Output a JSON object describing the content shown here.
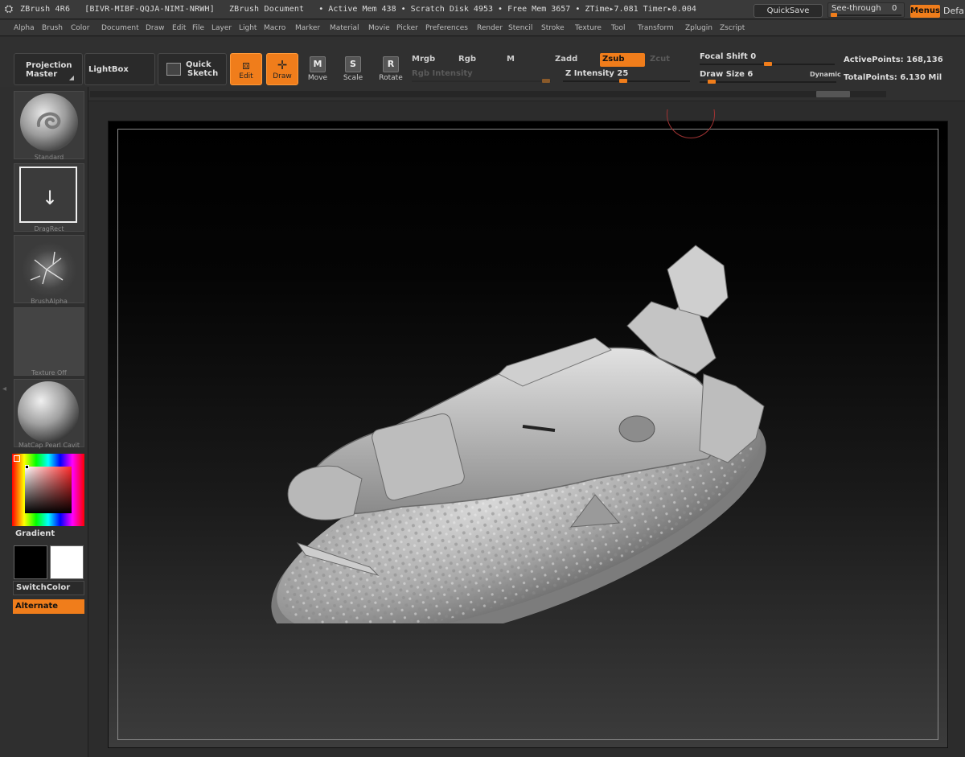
{
  "titlebar": {
    "app": "ZBrush 4R6",
    "serial": "[BIVR-MIBF-QQJA-NIMI-NRWH]",
    "document": "ZBrush Document",
    "stats": "• Active Mem 438 • Scratch Disk 4953 • Free Mem 3657 • ZTime▸7.081 Timer▸0.004",
    "quicksave": "QuickSave",
    "see_through_label": "See-through",
    "see_through_value": "0",
    "menus": "Menus",
    "default": "Defa"
  },
  "menubar": [
    "Alpha",
    "Brush",
    "Color",
    "Document",
    "Draw",
    "Edit",
    "File",
    "Layer",
    "Light",
    "Macro",
    "Marker",
    "Material",
    "Movie",
    "Picker",
    "Preferences",
    "Render",
    "Stencil",
    "Stroke",
    "Texture",
    "Tool",
    "Transform",
    "Zplugin",
    "Zscript"
  ],
  "toolbar": {
    "projection_master_1": "Projection",
    "projection_master_2": "Master",
    "lightbox": "LightBox",
    "quick_sketch_1": "Quick",
    "quick_sketch_2": "Sketch",
    "edit": "Edit",
    "draw": "Draw",
    "move": "Move",
    "move_key": "M",
    "scale": "Scale",
    "scale_key": "S",
    "rotate": "Rotate",
    "rotate_key": "R",
    "mrgb": "Mrgb",
    "rgb": "Rgb",
    "m": "M",
    "rgb_intensity": "Rgb Intensity",
    "zadd": "Zadd",
    "zsub": "Zsub",
    "zcut": "Zcut",
    "z_intensity": "Z Intensity 25",
    "focal_shift": "Focal Shift 0",
    "draw_size": "Draw Size 6",
    "dynamic": "Dynamic",
    "active_points": "ActivePoints: 168,136",
    "total_points": "TotalPoints: 6.130 Mil"
  },
  "lefttray": {
    "standard": "Standard",
    "dragrect": "DragRect",
    "brushalpha": "BrushAlpha",
    "texture_off": "Texture Off",
    "matcap": "MatCap Pearl Cavit",
    "gradient": "Gradient",
    "switchcolor": "SwitchColor",
    "alternate": "Alternate"
  },
  "colors": {
    "accent": "#f07d1b",
    "primary_color": "#000000",
    "secondary_color": "#ffffff"
  }
}
